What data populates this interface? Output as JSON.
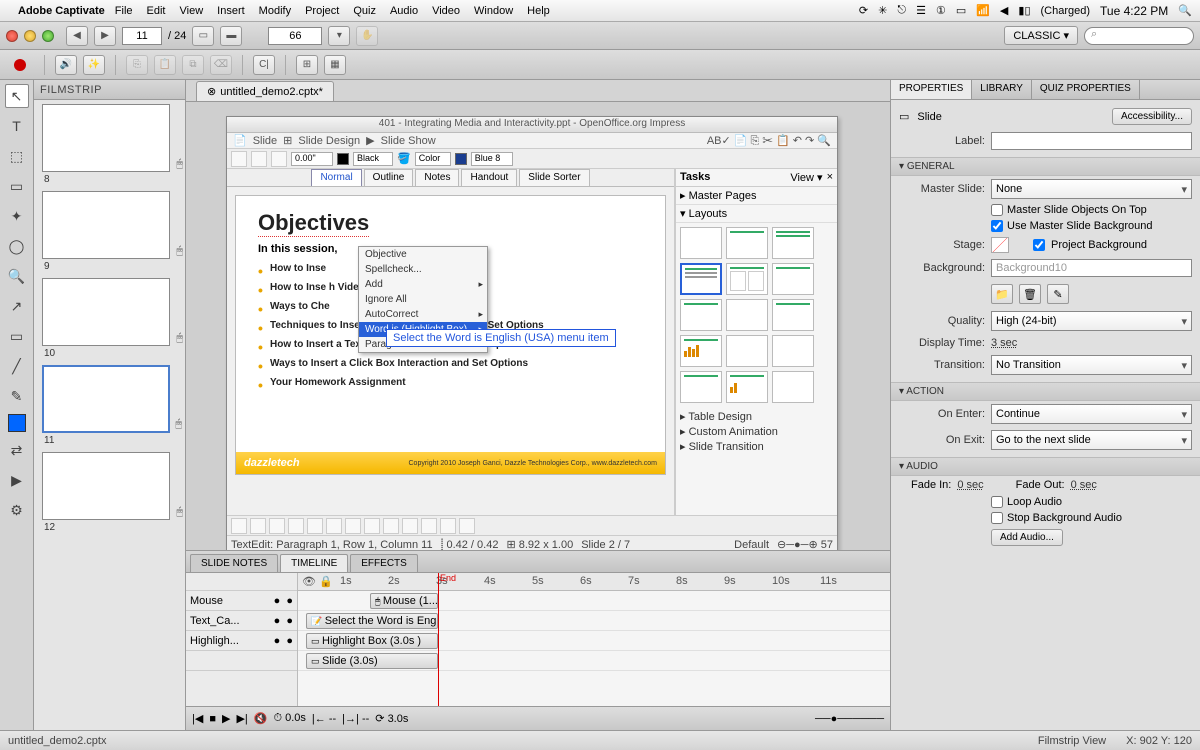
{
  "menubar": {
    "app": "Adobe Captivate",
    "items": [
      "File",
      "Edit",
      "View",
      "Insert",
      "Modify",
      "Project",
      "Quiz",
      "Audio",
      "Video",
      "Window",
      "Help"
    ],
    "battery": "(Charged)",
    "clock": "Tue 4:22 PM"
  },
  "toolbar": {
    "slide_num": "11",
    "slide_total": "/ 24",
    "zoom": "66",
    "workspace": "CLASSIC ▾"
  },
  "doc_tab": {
    "title": "untitled_demo2.cptx*"
  },
  "filmstrip": {
    "title": "FILMSTRIP",
    "nums": [
      "8",
      "9",
      "10",
      "11",
      "12"
    ]
  },
  "impress": {
    "window_title": "401 - Integrating Media and Interactivity.ppt - OpenOffice.org Impress",
    "menu_items": [
      "Slide",
      "Slide Design",
      "Slide Show"
    ],
    "tb_zoom": "0.00\"",
    "color_black": "Black",
    "color_name": "Color",
    "color_blue": "Blue 8",
    "view_tabs": [
      "Normal",
      "Outline",
      "Notes",
      "Handout",
      "Slide Sorter"
    ],
    "objectives_title": "Objectives",
    "subtitle": "In this session,",
    "bullets": [
      "How to Inse",
      "How to Inse                                    h Videos",
      "Ways to Che",
      "Techniques to Insert a Button Interaction and Set Options",
      "How to Insert a Text Entry Interaction and Set Options",
      "Ways to Insert a Click Box Interaction and Set Options",
      "Your Homework Assignment"
    ],
    "dazzle": "dazzletech",
    "dazzle_copy": "Copyright 2010\nJoseph Ganci, Dazzle Technologies Corp., www.dazzletech.com",
    "ctx_items": [
      "Objective",
      "Spellcheck...",
      "Add",
      "Ignore All",
      "AutoCorrect",
      "Word is (Highlight Box)",
      "Parag"
    ],
    "tooltip": "Select the Word is English (USA) menu item",
    "tasks_title": "Tasks",
    "tasks_view": "View ▾",
    "tasks_master": "Master Pages",
    "tasks_layouts": "Layouts",
    "tasks_links": [
      "Table Design",
      "Custom Animation",
      "Slide Transition"
    ],
    "status_left": "TextEdit: Paragraph 1, Row 1, Column 11",
    "status_mid1": "0.42 / 0.42",
    "status_mid2": "8.92 x 1.00",
    "status_slide": "Slide 2 / 7",
    "status_def": "Default",
    "status_pct": "57"
  },
  "timeline": {
    "tabs": [
      "SLIDE NOTES",
      "TIMELINE",
      "EFFECTS"
    ],
    "tracks": [
      "Mouse",
      "Text_Ca...",
      "Highligh..."
    ],
    "ruler": [
      "1s",
      "2s",
      "3s",
      "4s",
      "5s",
      "6s",
      "7s",
      "8s",
      "9s",
      "10s",
      "11s"
    ],
    "clip_mouse": "Mouse (1....",
    "clip_text": "Select the Word is English ...",
    "clip_hl": "Highlight Box (3.0s )",
    "clip_slide": "Slide (3.0s)",
    "time_elapsed": "0.0s",
    "time_total": "3.0s"
  },
  "props": {
    "tabs": [
      "PROPERTIES",
      "LIBRARY",
      "QUIZ PROPERTIES"
    ],
    "type": "Slide",
    "accessibility": "Accessibility...",
    "label_label": "Label:",
    "sec_general": "GENERAL",
    "master_label": "Master Slide:",
    "master_value": "None",
    "chk_objects": "Master Slide Objects On Top",
    "chk_usebg": "Use Master Slide Background",
    "stage_label": "Stage:",
    "chk_projbg": "Project Background",
    "bg_label": "Background:",
    "bg_value": "Background10",
    "quality_label": "Quality:",
    "quality_value": "High (24-bit)",
    "disp_label": "Display Time:",
    "disp_value": "3 sec",
    "trans_label": "Transition:",
    "trans_value": "No Transition",
    "sec_action": "ACTION",
    "enter_label": "On Enter:",
    "enter_value": "Continue",
    "exit_label": "On Exit:",
    "exit_value": "Go to the next slide",
    "sec_audio": "AUDIO",
    "fadein_label": "Fade In:",
    "fadein_value": "0 sec",
    "fadeout_label": "Fade Out:",
    "fadeout_value": "0 sec",
    "chk_loop": "Loop Audio",
    "chk_stopbg": "Stop Background Audio",
    "add_audio": "Add Audio..."
  },
  "statusbar": {
    "file": "untitled_demo2.cptx",
    "view": "Filmstrip View",
    "coords": "X: 902 Y: 120"
  }
}
